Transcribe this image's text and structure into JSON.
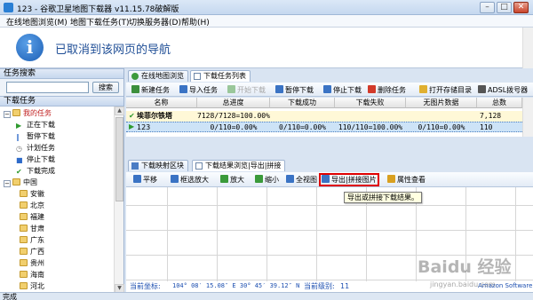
{
  "window": {
    "title": "123 - 谷歌卫星地图下载器 v11.15.78破解版",
    "controls": [
      "–",
      "□",
      "✕"
    ]
  },
  "menu": [
    "在线地图浏览(M)",
    "地图下载任务(T)",
    "切换服务器(D)",
    "帮助(H)"
  ],
  "browser": {
    "message": "已取消到该网页的导航",
    "icon_glyph": "i"
  },
  "left_panel": {
    "search_header": "任务搜索",
    "search_button": "搜索",
    "search_value": "",
    "tasks_header": "下载任务",
    "tree": [
      {
        "label": "我的任务",
        "level": 0,
        "expander": "−",
        "icon": "folder-icon",
        "color": "#c02020"
      },
      {
        "label": "正在下载",
        "level": 1,
        "icon": "play-icon",
        "color": "#2e9a2e"
      },
      {
        "label": "暂停下载",
        "level": 1,
        "icon": "pause-icon",
        "color": "#2e6ac9"
      },
      {
        "label": "计划任务",
        "level": 1,
        "icon": "clock-icon",
        "color": "#7a7a7a"
      },
      {
        "label": "停止下载",
        "level": 1,
        "icon": "stop-icon",
        "color": "#2e6ac9"
      },
      {
        "label": "下载完成",
        "level": 1,
        "icon": "check-icon",
        "color": "#2e9a2e"
      },
      {
        "label": "中国",
        "level": 0,
        "expander": "−",
        "icon": "folder-icon"
      },
      {
        "label": "安徽",
        "level": 2,
        "icon": "folder-icon"
      },
      {
        "label": "北京",
        "level": 2,
        "icon": "folder-icon"
      },
      {
        "label": "福建",
        "level": 2,
        "icon": "folder-icon"
      },
      {
        "label": "甘肃",
        "level": 2,
        "icon": "folder-icon"
      },
      {
        "label": "广东",
        "level": 2,
        "icon": "folder-icon"
      },
      {
        "label": "广西",
        "level": 2,
        "icon": "folder-icon"
      },
      {
        "label": "贵州",
        "level": 2,
        "icon": "folder-icon"
      },
      {
        "label": "海南",
        "level": 2,
        "icon": "folder-icon"
      },
      {
        "label": "河北",
        "level": 2,
        "icon": "folder-icon"
      }
    ]
  },
  "top_tabs": [
    "在线地图浏览",
    "下载任务列表"
  ],
  "toolbar": [
    {
      "label": "新建任务",
      "icon": "new-task-icon",
      "color": "#3c8f3c",
      "enabled": true
    },
    {
      "label": "导入任务",
      "icon": "import-icon",
      "color": "#3a73c4",
      "enabled": true
    },
    {
      "label": "开始下载",
      "icon": "start-icon",
      "color": "#9ac79a",
      "enabled": false
    },
    {
      "label": "暂停下载",
      "icon": "pause-icon",
      "color": "#3a73c4",
      "enabled": true
    },
    {
      "label": "停止下载",
      "icon": "stop-icon",
      "color": "#3a73c4",
      "enabled": true
    },
    {
      "label": "删除任务",
      "icon": "delete-icon",
      "color": "#d23a2a",
      "enabled": true
    },
    {
      "label": "打开存储目录",
      "icon": "open-folder-icon",
      "color": "#e0b030",
      "enabled": true
    },
    {
      "label": "ADSL拨号器",
      "icon": "adsl-icon",
      "color": "#555555",
      "enabled": true
    }
  ],
  "grid": {
    "columns": [
      "名称",
      "总进度",
      "下载成功",
      "下载失败",
      "无图片数据",
      "总数"
    ],
    "rows": [
      {
        "status_icon": "check-icon",
        "status_color": "#2e9a2e",
        "cells": [
          "埃菲尔铁塔",
          "7128/7128=100.00%",
          "",
          "",
          "",
          "7,128"
        ]
      },
      {
        "status_icon": "play-icon",
        "status_color": "#2e9a2e",
        "cells": [
          "123",
          "0/110=0.00%",
          "0/110=0.00%",
          "110/110=100.00%",
          "0/110=0.00%",
          "110"
        ]
      }
    ]
  },
  "bottom_tabs": [
    "下载映射区块",
    "下载结果浏览|导出|拼接"
  ],
  "map_toolbar": [
    {
      "label": "平移",
      "icon": "pan-icon"
    },
    {
      "label": "框选放大",
      "icon": "box-zoom-icon"
    },
    {
      "label": "放大",
      "icon": "zoom-in-icon"
    },
    {
      "label": "缩小",
      "icon": "zoom-out-icon"
    },
    {
      "label": "全视图",
      "icon": "full-view-icon"
    },
    {
      "label": "导出|拼接图片",
      "icon": "export-icon"
    },
    {
      "label": "属性查看",
      "icon": "properties-icon"
    }
  ],
  "tooltip": "导出或拼接下载结果。",
  "coords": {
    "label": "当前坐标:",
    "value": "104° 08′ 15.08″ E  30° 45′ 39.12″ N",
    "level_label": "当前级别:",
    "level_value": "11",
    "brand": "Amazon Software"
  },
  "status": "完成",
  "watermark": {
    "text": "Baidu 经验",
    "sub": "jingyan.baidu.com"
  }
}
